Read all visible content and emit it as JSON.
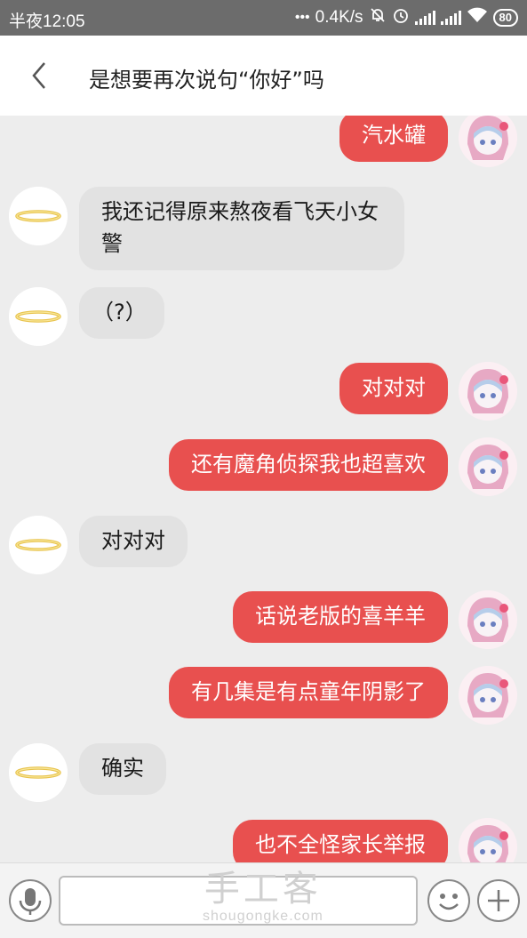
{
  "status_bar": {
    "time": "半夜12:05",
    "network_speed": "0.4K/s",
    "battery": "80"
  },
  "header": {
    "title": "是想要再次说句“你好”吗",
    "back_icon": "chevron-left-icon"
  },
  "messages": [
    {
      "sender": "me",
      "text": "汽水罐"
    },
    {
      "sender": "other",
      "text": "我还记得原来熬夜看飞天小女警"
    },
    {
      "sender": "other",
      "text": "（?）"
    },
    {
      "sender": "me",
      "text": "对对对"
    },
    {
      "sender": "me",
      "text": "还有魔角侦探我也超喜欢"
    },
    {
      "sender": "other",
      "text": "对对对"
    },
    {
      "sender": "me",
      "text": "话说老版的喜羊羊"
    },
    {
      "sender": "me",
      "text": "有几集是有点童年阴影了"
    },
    {
      "sender": "other",
      "text": "确实"
    },
    {
      "sender": "me",
      "text": "也不全怪家长举报"
    }
  ],
  "input_bar": {
    "voice_icon": "microphone-icon",
    "emoji_icon": "smiley-icon",
    "plus_icon": "plus-icon",
    "text_value": ""
  },
  "watermark": {
    "name": "手工客",
    "url": "shougongke.com"
  },
  "colors": {
    "my_bubble": "#e8504f",
    "other_bubble": "#e2e2e2",
    "status_bar": "#6c6c6c"
  }
}
